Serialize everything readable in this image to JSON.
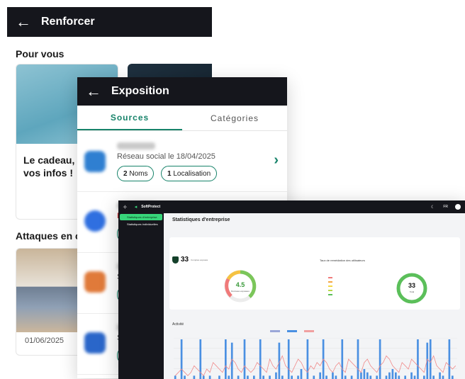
{
  "renforcer": {
    "title": "Renforcer",
    "section_for_you": "Pour vous",
    "card_text": "Le cadeau, vos infos !",
    "section_attacks": "Attaques en c",
    "attack_date": "01/06/2025"
  },
  "exposition": {
    "title": "Exposition",
    "tabs": [
      {
        "label": "Sources",
        "active": true
      },
      {
        "label": "Catégories",
        "active": false
      }
    ],
    "sources": [
      {
        "subtitle": "Réseau social le 18/04/2025",
        "chips": [
          {
            "count": "2",
            "label": "Noms"
          },
          {
            "count": "1",
            "label": "Localisation"
          }
        ],
        "color": "#2f7fd1"
      },
      {
        "subtitle": "F",
        "chips": [],
        "color": "#2f6fe0"
      },
      {
        "subtitle": "S",
        "chips": [],
        "color": "#e07a3a"
      },
      {
        "subtitle": "S",
        "chips": [],
        "color": "#2a66c9"
      }
    ]
  },
  "dashboard": {
    "brand": "SoftProtect",
    "lang": "FR",
    "nav": [
      {
        "label": "Statistiques d'entreprise",
        "active": true
      },
      {
        "label": "Statistiques individuelles",
        "active": false
      }
    ],
    "page_title": "Statistiques d'entreprise",
    "exposed_count": "33",
    "exposed_label": "Comptes exposés",
    "remediation_title": "Taux de remédiation des utilisateurs",
    "gauge_value": "4.5",
    "gauge_label": "Données exposées",
    "donut_value": "33",
    "donut_label": "Total",
    "activity_title": "Activité",
    "colors": {
      "accent": "#37d67a",
      "brand_green": "#17836a",
      "bar_blue": "#4a90e2",
      "line_pink": "#f08a8a"
    }
  },
  "chart_data": {
    "type": "bar",
    "title": "Activité",
    "series": [
      {
        "name": "",
        "values": [
          1,
          0,
          12,
          1,
          0,
          0,
          1,
          0,
          12,
          1,
          0,
          1,
          0,
          0,
          1,
          0,
          12,
          1,
          11,
          0,
          1,
          0,
          12,
          1,
          0,
          1,
          0,
          12,
          1,
          0,
          1,
          0,
          2,
          11,
          1,
          0,
          12,
          1,
          0,
          1,
          3,
          0,
          12,
          0,
          1,
          0,
          2,
          12,
          1,
          0,
          2,
          1,
          0,
          12,
          1,
          0,
          1,
          0,
          12,
          2,
          3,
          2,
          1,
          0,
          1,
          12,
          0,
          1,
          2,
          3,
          2,
          1,
          0,
          1,
          0,
          2,
          1,
          12,
          0,
          1,
          11,
          12,
          1,
          0,
          2,
          1,
          0,
          12,
          1,
          0
        ]
      },
      {
        "name": "",
        "values": [
          1,
          2,
          3,
          2,
          1,
          2,
          4,
          3,
          2,
          1,
          3,
          2,
          5,
          4,
          3,
          2,
          4,
          3,
          6,
          5,
          3,
          2,
          4,
          3,
          2,
          3,
          5,
          4,
          3,
          2,
          6,
          4,
          3,
          5,
          7,
          4,
          3,
          2,
          4,
          6,
          5,
          3,
          2,
          4,
          3,
          5,
          4,
          6,
          5,
          3,
          2,
          4,
          5,
          3,
          2,
          6,
          5,
          4,
          3,
          2,
          5,
          6,
          4,
          3,
          2,
          4,
          5,
          7,
          6,
          4,
          3,
          2,
          5,
          4,
          3,
          6,
          5,
          4,
          3,
          2,
          6,
          5,
          7,
          4,
          3,
          2,
          5,
          4,
          3,
          4
        ]
      }
    ]
  }
}
